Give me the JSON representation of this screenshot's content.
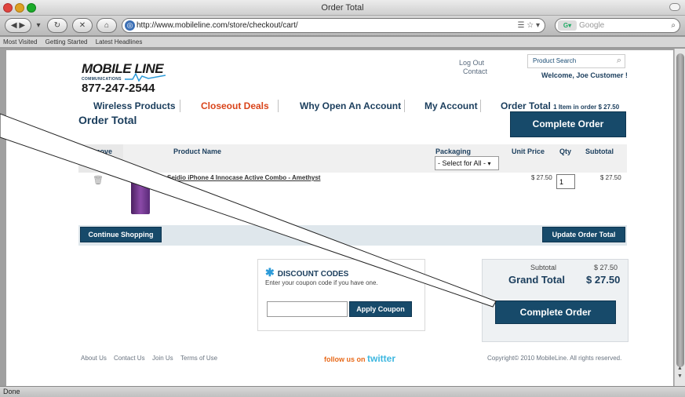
{
  "browser": {
    "window_title": "Order Total",
    "url": "http://www.mobileline.com/store/checkout/cart/",
    "search_placeholder": "Google",
    "bookmarks": [
      "Most Visited",
      "Getting Started",
      "Latest Headlines"
    ],
    "status": "Done"
  },
  "header": {
    "logo_main": "MOBILE LINE",
    "logo_sub": "COMMUNICATIONS",
    "phone": "877-247-2544",
    "logout": "Log Out",
    "contact": "Contact",
    "product_search": "Product Search",
    "welcome": "Welcome, Joe Customer !"
  },
  "nav": {
    "wireless": "Wireless Products",
    "closeout": "Closeout Deals",
    "why_open": "Why Open An Account",
    "my_account": "My Account",
    "order_total": "Order Total",
    "order_summary": "1 Item in order $ 27.50"
  },
  "cart": {
    "title": "Order Total",
    "complete_order": "Complete Order",
    "columns": {
      "remove": "Remove",
      "product_name": "Product Name",
      "packaging": "Packaging",
      "unit_price": "Unit Price",
      "qty": "Qty",
      "subtotal": "Subtotal"
    },
    "select_all": "- Select for All -",
    "items": [
      {
        "name": "Seidio iPhone 4 Innocase Active Combo - Amethyst",
        "unit_price": "$ 27.50",
        "qty": "1",
        "subtotal": "$ 27.50"
      }
    ],
    "continue_shopping": "Continue Shopping",
    "update_total": "Update Order Total"
  },
  "discount": {
    "title": "DISCOUNT CODES",
    "hint": "Enter your coupon code if you have one.",
    "apply": "Apply Coupon"
  },
  "totals": {
    "subtotal_label": "Subtotal",
    "subtotal_value": "$ 27.50",
    "grand_label": "Grand Total",
    "grand_value": "$ 27.50",
    "complete_order": "Complete Order"
  },
  "footer": {
    "about": "About Us",
    "contact": "Contact Us",
    "join": "Join Us",
    "terms": "Terms of Use",
    "follow_prefix": "follow us on",
    "twitter": "twitter",
    "copyright": "Copyright© 2010 MobileLine. All rights reserved."
  }
}
